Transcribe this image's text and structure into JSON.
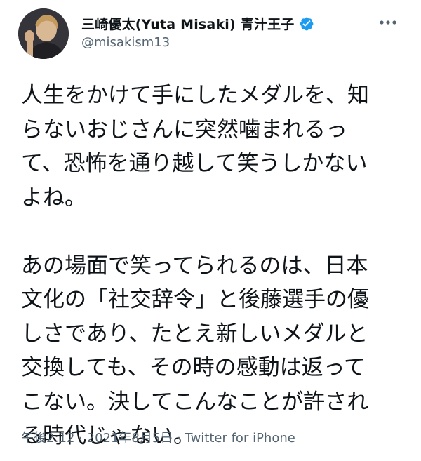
{
  "tweet": {
    "author": {
      "display_name": "三崎優太(Yuta Misaki) 青汁王子",
      "handle": "@misakism13",
      "verified": true,
      "avatar_icon": "user-avatar"
    },
    "more_icon": "more-horizontal-icon",
    "paragraphs": [
      {
        "lines": [
          "人生をかけて手にしたメダルを、知",
          "らないおじさんに突然噛まれるっ",
          "て、恐怖を通り越して笑うしかない",
          "よね。"
        ]
      },
      {
        "lines": [
          "あの場面で笑ってられるのは、日本",
          "文化の「社交辞令」と後藤選手の優",
          "しさであり、たとえ新しいメダルと",
          "交換しても、その時の感動は返って",
          "こない。決してこんなことが許され",
          "る時代じゃない。"
        ]
      }
    ],
    "time": "午後2:12",
    "separator": "·",
    "date": "2021年8月5日",
    "source": "Twitter for iPhone"
  },
  "colors": {
    "text": "#0f1419",
    "secondary": "#536471",
    "verified": "#1d9bf0"
  }
}
